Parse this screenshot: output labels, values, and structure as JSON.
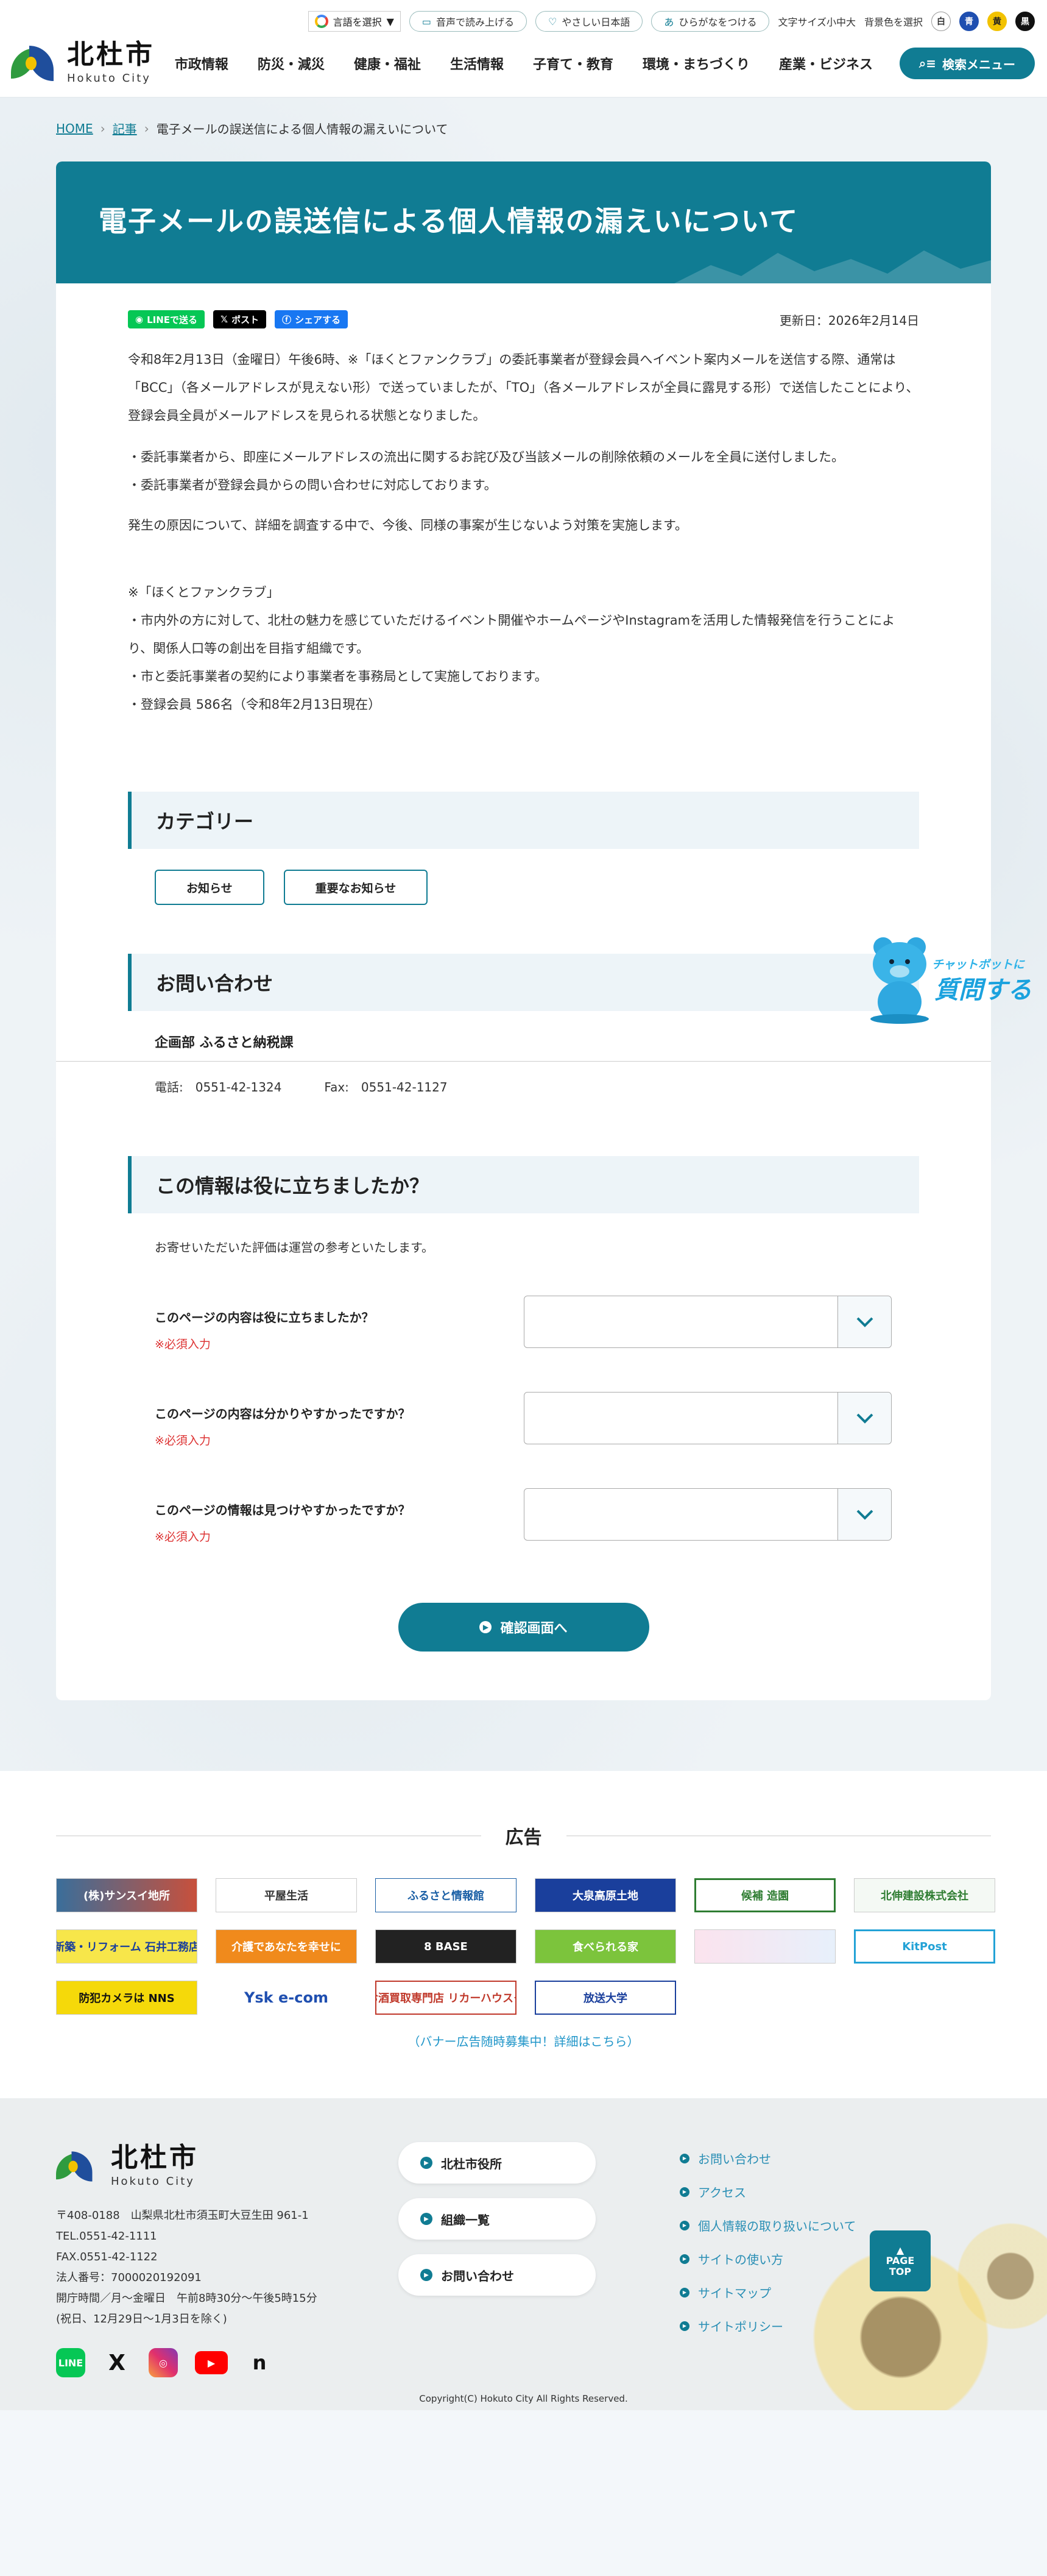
{
  "header": {
    "logo_jp": "北杜市",
    "logo_en": "Hokuto City",
    "lang_select": "言語を選択",
    "read_aloud": "音声で読み上げる",
    "easy_japanese": "やさしい日本語",
    "hiragana": "ひらがなをつける",
    "font_size_label": "文字サイズ小中大",
    "bg_color_label": "背景色を選択",
    "color_white": "白",
    "color_blue": "青",
    "color_yellow": "黄",
    "color_black": "黒",
    "nav": [
      "市政情報",
      "防災・減災",
      "健康・福祉",
      "生活情報",
      "子育て・教育",
      "環境・まちづくり",
      "産業・ビジネス"
    ],
    "search_menu": "検索メニュー"
  },
  "breadcrumb": {
    "home": "HOME",
    "articles": "記事",
    "current": "電子メールの誤送信による個人情報の漏えいについて"
  },
  "article": {
    "title": "電子メールの誤送信による個人情報の漏えいについて",
    "share_line": "LINEで送る",
    "share_x": "ポスト",
    "share_fb": "シェアする",
    "updated": "更新日：2026年2月14日",
    "p1": "令和8年2月13日（金曜日）午後6時、※「ほくとファンクラブ」の委託事業者が登録会員へイベント案内メールを送信する際、通常は「BCC」（各メールアドレスが見えない形）で送っていましたが、「TO」（各メールアドレスが全員に露見する形）で送信したことにより、登録会員全員がメールアドレスを見られる状態となりました。",
    "p2a": "・委託事業者から、即座にメールアドレスの流出に関するお詫び及び当該メールの削除依頼のメールを全員に送付しました。",
    "p2b": "・委託事業者が登録会員からの問い合わせに対応しております。",
    "p3": "発生の原因について、詳細を調査する中で、今後、同様の事案が生じないよう対策を実施します。",
    "n1": "※「ほくとファンクラブ」",
    "n2": "・市内外の方に対して、北杜の魅力を感じていただけるイベント開催やホームページやInstagramを活用した情報発信を行うことにより、関係人口等の創出を目指す組織です。",
    "n3": "・市と委託事業者の契約により事業者を事務局として実施しております。",
    "n4": "・登録会員 586名（令和8年2月13日現在）"
  },
  "category": {
    "heading": "カテゴリー",
    "items": [
      "お知らせ",
      "重要なお知らせ"
    ]
  },
  "contact": {
    "heading": "お問い合わせ",
    "dept": "企画部 ふるさと納税課",
    "tel": "電話:　0551-42-1324",
    "fax": "Fax:　0551-42-1127"
  },
  "feedback": {
    "heading": "この情報は役に立ちましたか？",
    "note": "お寄せいただいた評価は運営の参考といたします。",
    "required": "※必須入力",
    "questions": [
      "このページの内容は役に立ちましたか？",
      "このページの内容は分かりやすかったですか？",
      "このページの情報は見つけやすかったですか？"
    ],
    "confirm": "確認画面へ"
  },
  "chatbot": {
    "small": "チャットボットに",
    "big": "質問する"
  },
  "ads": {
    "heading": "広告",
    "items": [
      "(株)サンスイ地所",
      "平屋生活",
      "ふるさと情報館",
      "大泉高原土地",
      "候補 造園",
      "北伸建設株式会社",
      "新築・リフォーム 石井工務店",
      "介護であなたを幸せに",
      "8 BASE",
      "食べられる家",
      "",
      "KitPost",
      "防犯カメラは NNS",
      "Ysk e-com",
      "お酒買取専門店 リカーハウスタ",
      "放送大学"
    ],
    "more": "（バナー広告随時募集中！詳細はこちら）"
  },
  "pagetop": {
    "l1": "PAGE",
    "l2": "TOP"
  },
  "footer": {
    "logo_jp": "北杜市",
    "logo_en": "Hokuto City",
    "addr1": "〒408-0188　山梨県北杜市須玉町大豆生田 961-1",
    "addr2": "TEL.0551-42-1111",
    "addr3": "FAX.0551-42-1122",
    "addr4": "法人番号：7000020192091",
    "addr5": "開庁時間／月～金曜日　午前8時30分～午後5時15分",
    "addr6": "(祝日、12月29日～1月3日を除く)",
    "buttons": [
      "北杜市役所",
      "組織一覧",
      "お問い合わせ"
    ],
    "links": [
      "お問い合わせ",
      "アクセス",
      "個人情報の取り扱いについて",
      "サイトの使い方",
      "サイトマップ",
      "サイトポリシー"
    ],
    "copyright": "Copyright(C) Hokuto City All Rights Reserved.",
    "sns_line": "LINE",
    "sns_x": "X",
    "sns_note": "n"
  },
  "colors": {
    "accent": "#107c93",
    "required": "#dd3333",
    "link": "#2a8fb5"
  }
}
